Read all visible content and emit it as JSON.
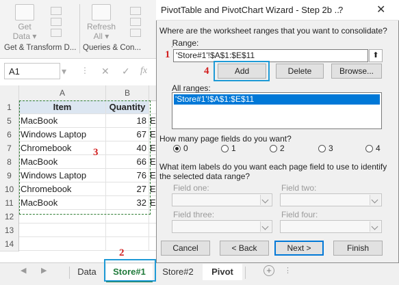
{
  "ribbon": {
    "get_data_label_1": "Get",
    "get_data_label_2": "Data ▾",
    "refresh_label_1": "Refresh",
    "refresh_label_2": "All ▾",
    "group_get_transform": "Get & Transform D...",
    "group_queries": "Queries & Con..."
  },
  "formula_bar": {
    "name_box": "A1"
  },
  "sheet": {
    "col_a": "A",
    "col_b": "B",
    "rows": [
      {
        "num": "1",
        "item": "Item",
        "qty": "Quantity",
        "header": true
      },
      {
        "num": "5",
        "item": "MacBook",
        "qty": "18"
      },
      {
        "num": "6",
        "item": "Windows Laptop",
        "qty": "67"
      },
      {
        "num": "7",
        "item": "Chromebook",
        "qty": "40"
      },
      {
        "num": "8",
        "item": "MacBook",
        "qty": "66"
      },
      {
        "num": "9",
        "item": "Windows Laptop",
        "qty": "76"
      },
      {
        "num": "10",
        "item": "Chromebook",
        "qty": "27"
      },
      {
        "num": "11",
        "item": "MacBook",
        "qty": "32"
      },
      {
        "num": "12",
        "item": "",
        "qty": ""
      },
      {
        "num": "13",
        "item": "",
        "qty": ""
      },
      {
        "num": "14",
        "item": "",
        "qty": ""
      }
    ],
    "overflow_char": "E"
  },
  "tabs": [
    "Data",
    "Store#1",
    "Store#2",
    "Pivot"
  ],
  "callouts": {
    "one": "1",
    "two": "2",
    "three": "3",
    "four": "4"
  },
  "dialog": {
    "title": "PivotTable and PivotChart Wizard - Step 2b ...",
    "help": "?",
    "close": "✕",
    "question_ranges": "Where are the worksheet ranges that you want to consolidate?",
    "range_label": "Range:",
    "range_value": "'Store#1'!$A$1:$E$11",
    "add_button": "Add",
    "delete_button": "Delete",
    "browse_button": "Browse...",
    "all_ranges_label": "All ranges:",
    "all_ranges_items": [
      "'Store#1'!$A$1:$E$11"
    ],
    "page_fields_question": "How many page fields do you want?",
    "page_field_options": [
      "0",
      "1",
      "2",
      "3",
      "4"
    ],
    "page_field_selected": "0",
    "labels_question_1": "What item labels do you want each page field to use to identify",
    "labels_question_2": "the selected data range?",
    "field_one": "Field one:",
    "field_two": "Field two:",
    "field_three": "Field three:",
    "field_four": "Field four:",
    "cancel_button": "Cancel",
    "back_button": "< Back",
    "next_button": "Next >",
    "finish_button": "Finish"
  }
}
